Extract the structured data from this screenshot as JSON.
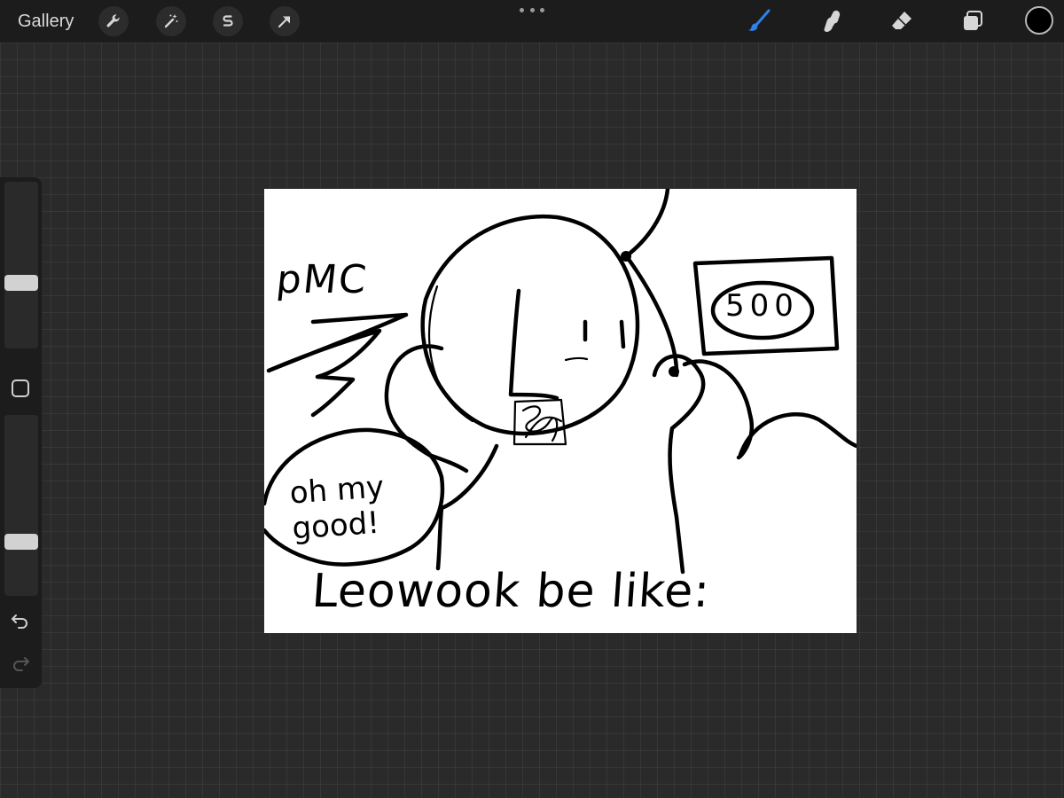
{
  "topbar": {
    "gallery_label": "Gallery",
    "left_tools": [
      "wrench-icon",
      "magic-wand-icon",
      "selection-icon",
      "move-arrow-icon"
    ],
    "right_tools": [
      "brush-icon",
      "smudge-icon",
      "eraser-icon",
      "layers-icon"
    ],
    "active_tool": "brush-icon",
    "active_color": "#000000",
    "accent_color": "#2f80ed"
  },
  "sidebar": {
    "brush_size_level": 0.62,
    "opacity_level": 0.72,
    "icons": [
      "modify-square-icon",
      "undo-icon",
      "redo-icon"
    ]
  },
  "canvas": {
    "handwriting": {
      "pmc": "pMC",
      "score": "500",
      "speech": "oh my good!",
      "caption": "Leowook be like:"
    }
  }
}
